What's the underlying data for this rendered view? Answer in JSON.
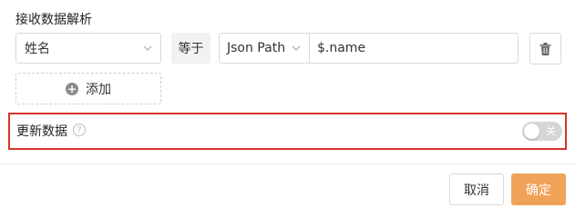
{
  "section": {
    "title": "接收数据解析"
  },
  "row": {
    "field_value": "姓名",
    "operator_label": "等于",
    "type_value": "Json Path",
    "path_value": "$.name"
  },
  "add_button": {
    "label": "添加"
  },
  "update": {
    "label": "更新数据",
    "toggle_text": "关",
    "toggle_on": false
  },
  "footer": {
    "cancel_label": "取消",
    "ok_label": "确定"
  },
  "colors": {
    "accent": "#f0a258",
    "highlight": "#d9342b",
    "toggle_off": "#d6d6d6"
  },
  "icons": {
    "delete": "trash-icon",
    "add": "plus-circle-icon",
    "help": "question-circle-icon",
    "dropdown": "chevron-down-icon"
  }
}
